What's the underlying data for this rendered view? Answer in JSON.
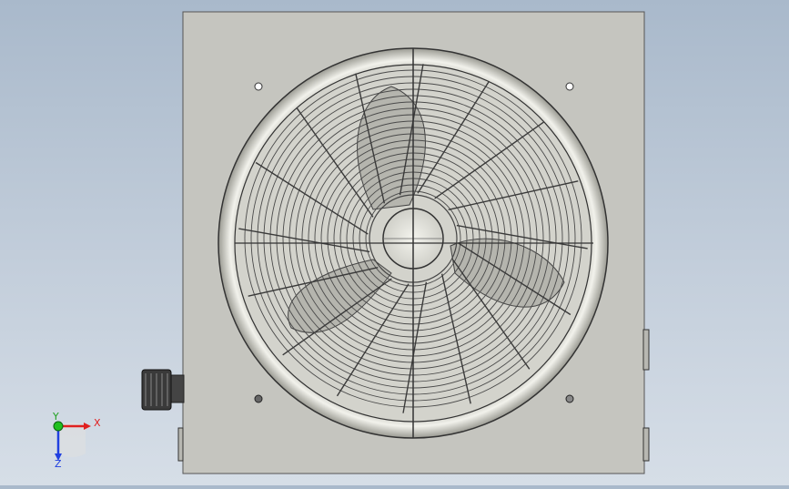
{
  "viewport": {
    "background_top": "#a9b9cb",
    "background_bottom": "#d6dee7"
  },
  "model": {
    "panel_color": "#c5c5bf",
    "guard_color": "#e8e8e2",
    "outline_color": "#3a3a3a"
  },
  "triad": {
    "x_label": "X",
    "y_label": "Y",
    "z_label": "Z",
    "x_color": "#e02020",
    "y_color": "#20c020",
    "z_color": "#2040e0"
  }
}
